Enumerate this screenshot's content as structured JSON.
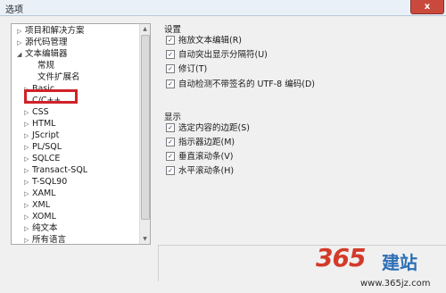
{
  "window": {
    "title": "选项",
    "close_glyph": "x"
  },
  "tree": {
    "items": [
      {
        "label": "项目和解决方案",
        "expand": "collapsed"
      },
      {
        "label": "源代码管理",
        "expand": "collapsed"
      },
      {
        "label": "文本编辑器",
        "expand": "expanded"
      },
      {
        "label": "常规",
        "expand": "none"
      },
      {
        "label": "文件扩展名",
        "expand": "none"
      },
      {
        "label": "Basic",
        "expand": "collapsed"
      },
      {
        "label": "C/C++",
        "expand": "collapsed",
        "highlighted": true
      },
      {
        "label": "CSS",
        "expand": "collapsed"
      },
      {
        "label": "HTML",
        "expand": "collapsed"
      },
      {
        "label": "JScript",
        "expand": "collapsed"
      },
      {
        "label": "PL/SQL",
        "expand": "collapsed"
      },
      {
        "label": "SQLCE",
        "expand": "collapsed"
      },
      {
        "label": "Transact-SQL",
        "expand": "collapsed"
      },
      {
        "label": "T-SQL90",
        "expand": "collapsed"
      },
      {
        "label": "XAML",
        "expand": "collapsed"
      },
      {
        "label": "XML",
        "expand": "collapsed"
      },
      {
        "label": "XOML",
        "expand": "collapsed"
      },
      {
        "label": "纯文本",
        "expand": "collapsed"
      },
      {
        "label": "所有语言",
        "expand": "collapsed"
      }
    ]
  },
  "settings": {
    "heading": "设置",
    "options": [
      {
        "label": "拖放文本编辑(R)",
        "checked": true
      },
      {
        "label": "自动突出显示分隔符(U)",
        "checked": true
      },
      {
        "label": "修订(T)",
        "checked": true
      },
      {
        "label": "自动检测不带签名的 UTF-8 编码(D)",
        "checked": true
      }
    ]
  },
  "display": {
    "heading": "显示",
    "options": [
      {
        "label": "选定内容的边距(S)",
        "checked": true
      },
      {
        "label": "指示器边距(M)",
        "checked": true
      },
      {
        "label": "垂直滚动条(V)",
        "checked": true
      },
      {
        "label": "水平滚动条(H)",
        "checked": true
      }
    ]
  },
  "watermark": {
    "number": "365",
    "chars": "建站",
    "url": "www.365jz.com"
  },
  "colors": {
    "highlight": "#d0212a",
    "checkmark": "#1e3b6a",
    "titlebar": "#e9f0f8",
    "close": "#c94a3c"
  }
}
